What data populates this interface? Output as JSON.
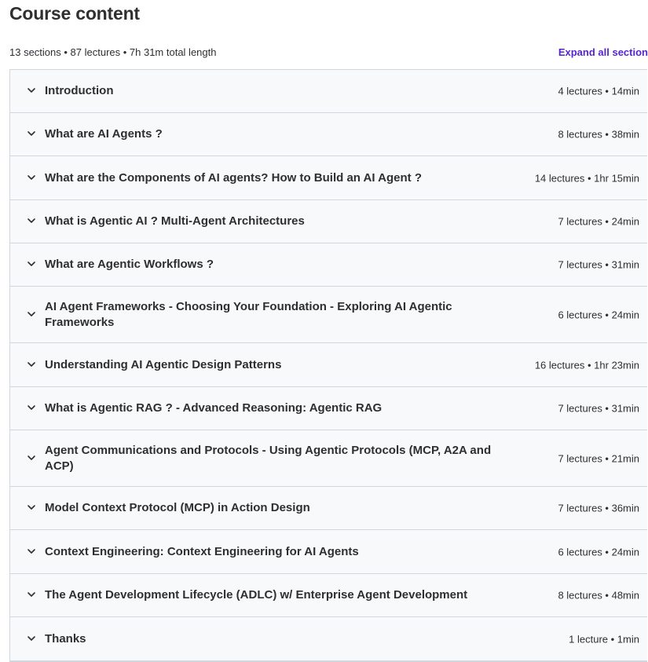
{
  "page": {
    "title": "Course content"
  },
  "summary": {
    "text": "13 sections • 87 lectures • 7h 31m total length",
    "expand_label": "Expand all section"
  },
  "sections": [
    {
      "title": "Introduction",
      "meta": "4 lectures • 14min"
    },
    {
      "title": "What are AI Agents ?",
      "meta": "8 lectures • 38min"
    },
    {
      "title": "What are the Components of AI agents? How to Build an AI Agent ?",
      "meta": "14 lectures • 1hr 15min"
    },
    {
      "title": "What is Agentic AI ? Multi-Agent Architectures",
      "meta": "7 lectures • 24min"
    },
    {
      "title": "What are Agentic Workflows ?",
      "meta": "7 lectures • 31min"
    },
    {
      "title": "AI Agent Frameworks - Choosing Your Foundation - Exploring AI Agentic Frameworks",
      "meta": "6 lectures • 24min"
    },
    {
      "title": "Understanding AI Agentic Design Patterns",
      "meta": "16 lectures • 1hr 23min"
    },
    {
      "title": "What is Agentic RAG ? - Advanced Reasoning: Agentic RAG",
      "meta": "7 lectures • 31min"
    },
    {
      "title": "Agent Communications and Protocols - Using Agentic Protocols (MCP, A2A and ACP)",
      "meta": "7 lectures • 21min"
    },
    {
      "title": "Model Context Protocol (MCP) in Action Design",
      "meta": "7 lectures • 36min"
    },
    {
      "title": "Context Engineering: Context Engineering for AI Agents",
      "meta": "6 lectures • 24min"
    },
    {
      "title": "The Agent Development Lifecycle (ADLC) w/ Enterprise Agent Development",
      "meta": "8 lectures • 48min"
    },
    {
      "title": "Thanks",
      "meta": "1 lecture • 1min"
    }
  ],
  "icons": {
    "section_toggle": "chevron-down-icon"
  },
  "colors": {
    "accent": "#5624d0",
    "section_bg": "#f7f9fa",
    "border": "#d1d7dc",
    "text": "#2d2f31"
  }
}
